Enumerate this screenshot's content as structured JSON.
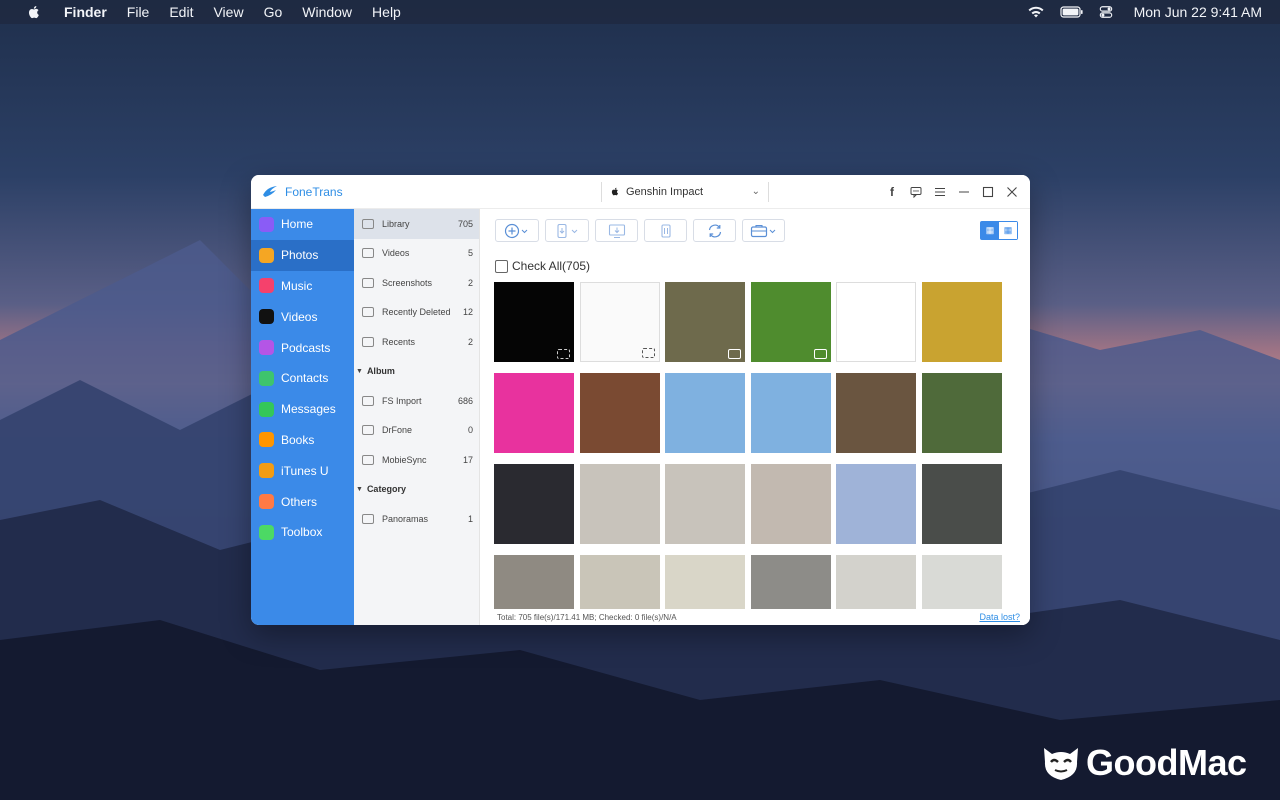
{
  "menubar": {
    "apple_icon": "apple-icon",
    "items": [
      "Finder",
      "File",
      "Edit",
      "View",
      "Go",
      "Window",
      "Help"
    ],
    "clock": "Mon Jun 22  9:41 AM",
    "status_icons": [
      "wifi-icon",
      "battery-icon",
      "control-center-icon"
    ]
  },
  "app": {
    "name": "FoneTrans",
    "device": "Genshin Impact",
    "window_controls": [
      "facebook-icon",
      "feedback-icon",
      "menu-icon",
      "minimize-icon",
      "maximize-icon",
      "close-icon"
    ],
    "nav": [
      {
        "label": "Home",
        "icon": "home-icon",
        "color": "#8a5cf6"
      },
      {
        "label": "Photos",
        "icon": "photos-icon",
        "color": "#f5a623",
        "active": true
      },
      {
        "label": "Music",
        "icon": "music-icon",
        "color": "#f5416c"
      },
      {
        "label": "Videos",
        "icon": "tv-icon",
        "color": "#111111"
      },
      {
        "label": "Podcasts",
        "icon": "podcasts-icon",
        "color": "#b455e6"
      },
      {
        "label": "Contacts",
        "icon": "contacts-icon",
        "color": "#3ec46d"
      },
      {
        "label": "Messages",
        "icon": "messages-icon",
        "color": "#34c759"
      },
      {
        "label": "Books",
        "icon": "books-icon",
        "color": "#ff9500"
      },
      {
        "label": "iTunes U",
        "icon": "itunes-u-icon",
        "color": "#f39c12"
      },
      {
        "label": "Others",
        "icon": "others-icon",
        "color": "#ff7a45"
      },
      {
        "label": "Toolbox",
        "icon": "toolbox-icon",
        "color": "#4cd964"
      }
    ],
    "library": [
      {
        "label": "Library",
        "count": "705",
        "active": true
      },
      {
        "label": "Videos",
        "count": "5"
      },
      {
        "label": "Screenshots",
        "count": "2"
      },
      {
        "label": "Recently Deleted",
        "count": "12"
      },
      {
        "label": "Recents",
        "count": "2"
      }
    ],
    "album_header": "Album",
    "albums": [
      {
        "label": "FS Import",
        "count": "686"
      },
      {
        "label": "DrFone",
        "count": "0"
      },
      {
        "label": "MobieSync",
        "count": "17"
      }
    ],
    "category_header": "Category",
    "categories": [
      {
        "label": "Panoramas",
        "count": "1"
      }
    ],
    "toolbar": [
      "add-icon",
      "export-to-device-icon",
      "export-to-pc-icon",
      "delete-icon",
      "refresh-icon",
      "toolbox-case-icon"
    ],
    "check_all": "Check All(705)",
    "footer_total": "Total: 705 file(s)/171.41 MB; Checked: 0 file(s)/N/A",
    "footer_link": "Data lost?",
    "thumbnails": [
      {
        "bg": "#050505",
        "kind": "screenshot"
      },
      {
        "bg": "#fafafa",
        "kind": "screenshot"
      },
      {
        "bg": "#6e6a4c",
        "kind": "video"
      },
      {
        "bg": "#4f8c2e",
        "kind": "video"
      },
      {
        "bg": "#ffffff",
        "kind": "photo"
      },
      {
        "bg": "#c9a330",
        "kind": "photo"
      },
      {
        "bg": "#e8329e",
        "kind": "photo"
      },
      {
        "bg": "#7a4a32",
        "kind": "photo"
      },
      {
        "bg": "#7fb1e0",
        "kind": "photo"
      },
      {
        "bg": "#7fb1e0",
        "kind": "photo"
      },
      {
        "bg": "#6a5540",
        "kind": "photo"
      },
      {
        "bg": "#4f6a3a",
        "kind": "photo"
      },
      {
        "bg": "#2a2a30",
        "kind": "photo"
      },
      {
        "bg": "#c8c3bb",
        "kind": "photo"
      },
      {
        "bg": "#c8c3bb",
        "kind": "photo"
      },
      {
        "bg": "#c2b9b0",
        "kind": "photo"
      },
      {
        "bg": "#9fb3d8",
        "kind": "photo"
      },
      {
        "bg": "#4a4d4a",
        "kind": "photo"
      },
      {
        "bg": "#8f8a82",
        "kind": "photo"
      },
      {
        "bg": "#c9c5b8",
        "kind": "photo"
      },
      {
        "bg": "#d9d6c8",
        "kind": "photo"
      },
      {
        "bg": "#8d8c88",
        "kind": "photo"
      },
      {
        "bg": "#d3d2cc",
        "kind": "photo"
      },
      {
        "bg": "#d9dad6",
        "kind": "photo"
      }
    ]
  },
  "watermark": "GoodMac"
}
